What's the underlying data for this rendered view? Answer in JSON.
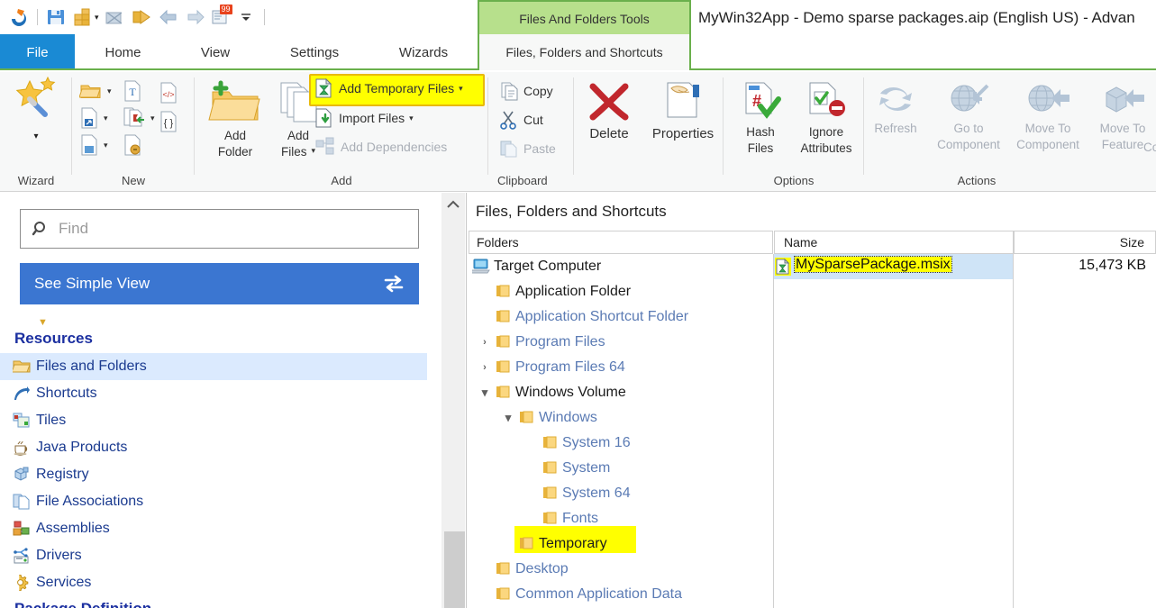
{
  "window": {
    "title": "MyWin32App - Demo sparse packages.aip (English US) - Advan",
    "contextual_tab_header": "Files And Folders Tools"
  },
  "quick_access": {
    "icons": [
      "app-logo-icon",
      "save-icon",
      "build-icon",
      "build-dropdown-caret",
      "build-and-run-icon",
      "run-icon",
      "back-arrow-icon",
      "forward-arrow-icon",
      "errors-badge-icon",
      "customize-qat-caret"
    ],
    "errors_badge": "99"
  },
  "tabs": [
    {
      "label": "File",
      "name": "tab-file",
      "state": "active-file"
    },
    {
      "label": "Home",
      "name": "tab-home",
      "state": "normal"
    },
    {
      "label": "View",
      "name": "tab-view",
      "state": "normal"
    },
    {
      "label": "Settings",
      "name": "tab-settings",
      "state": "normal"
    },
    {
      "label": "Wizards",
      "name": "tab-wizards",
      "state": "normal"
    },
    {
      "label": "Files, Folders and Shortcuts",
      "name": "tab-files-folders-shortcuts",
      "state": "selected-contextual"
    }
  ],
  "ribbon": {
    "groups": [
      {
        "label": "Wizard"
      },
      {
        "label": "New"
      },
      {
        "label": "Add"
      },
      {
        "label": "Clipboard"
      },
      {
        "label": "Options"
      },
      {
        "label": "Actions"
      }
    ],
    "wizard": {
      "button_label": "",
      "dropdown_caret": "▾"
    },
    "new_group": {
      "icons": [
        "new-folder-icon",
        "new-text-file-icon",
        "new-html-file-icon",
        "new-shortcut-icon",
        "new-import-shortcut-icon",
        "new-json-file-icon",
        "new-app-file-icon",
        "new-signed-file-icon"
      ]
    },
    "add_group": {
      "add_folder": "Add\nFolder",
      "add_folder_l1": "Add",
      "add_folder_l2": "Folder",
      "add_files_l1": "Add",
      "add_files_l2": "Files",
      "add_temporary_files": "Add Temporary Files",
      "import_files": "Import Files",
      "add_dependencies": "Add Dependencies"
    },
    "clipboard": {
      "copy": "Copy",
      "cut": "Cut",
      "paste": "Paste"
    },
    "delete": "Delete",
    "properties": "Properties",
    "options": {
      "hash_files_l1": "Hash",
      "hash_files_l2": "Files",
      "ignore_attributes_l1": "Ignore",
      "ignore_attributes_l2": "Attributes"
    },
    "actions": {
      "refresh": "Refresh",
      "go_to_component_l1": "Go to",
      "go_to_component_l2": "Component",
      "move_to_component_l1": "Move To",
      "move_to_component_l2": "Component",
      "move_to_feature_l1": "Move To",
      "move_to_feature_l2": "Feature",
      "cut_off_l1": "Co"
    }
  },
  "sidebar": {
    "search": {
      "placeholder": "Find",
      "value": ""
    },
    "simple_view_button": "See Simple View",
    "section_header": "Resources",
    "partial_section_header_below": "Package Definition",
    "items": [
      {
        "label": "Files and Folders",
        "icon": "open-folder-icon",
        "selected": true
      },
      {
        "label": "Shortcuts",
        "icon": "shortcut-arrow-icon",
        "selected": false
      },
      {
        "label": "Tiles",
        "icon": "tiles-icon",
        "selected": false
      },
      {
        "label": "Java Products",
        "icon": "coffee-cup-icon",
        "selected": false
      },
      {
        "label": "Registry",
        "icon": "registry-blocks-icon",
        "selected": false
      },
      {
        "label": "File Associations",
        "icon": "file-associations-icon",
        "selected": false
      },
      {
        "label": "Assemblies",
        "icon": "assemblies-icon",
        "selected": false
      },
      {
        "label": "Drivers",
        "icon": "drivers-icon",
        "selected": false
      },
      {
        "label": "Services",
        "icon": "services-gear-icon",
        "selected": false
      }
    ]
  },
  "main": {
    "panel_title": "Files, Folders and Shortcuts",
    "folders_column_header": "Folders",
    "name_column_header": "Name",
    "size_column_header": "Size",
    "tree": [
      {
        "label": "Target Computer",
        "depth": 0,
        "icon": "computer-icon",
        "toggle": "",
        "style": "dark",
        "highlight": false
      },
      {
        "label": "Application Folder",
        "depth": 1,
        "icon": "folder-icon",
        "toggle": "",
        "style": "dark",
        "highlight": false
      },
      {
        "label": "Application Shortcut Folder",
        "depth": 1,
        "icon": "folder-icon",
        "toggle": "",
        "style": "blue",
        "highlight": false
      },
      {
        "label": "Program Files",
        "depth": 1,
        "icon": "folder-icon",
        "toggle": "›",
        "style": "blue",
        "highlight": false
      },
      {
        "label": "Program Files 64",
        "depth": 1,
        "icon": "folder-icon",
        "toggle": "›",
        "style": "blue",
        "highlight": false
      },
      {
        "label": "Windows Volume",
        "depth": 1,
        "icon": "folder-icon",
        "toggle": "⌄",
        "style": "dark",
        "highlight": false
      },
      {
        "label": "Windows",
        "depth": 2,
        "icon": "folder-icon",
        "toggle": "⌄",
        "style": "blue",
        "highlight": false
      },
      {
        "label": "System 16",
        "depth": 3,
        "icon": "folder-icon",
        "toggle": "",
        "style": "blue",
        "highlight": false
      },
      {
        "label": "System",
        "depth": 3,
        "icon": "folder-icon",
        "toggle": "",
        "style": "blue",
        "highlight": false
      },
      {
        "label": "System 64",
        "depth": 3,
        "icon": "folder-icon",
        "toggle": "",
        "style": "blue",
        "highlight": false
      },
      {
        "label": "Fonts",
        "depth": 3,
        "icon": "folder-icon",
        "toggle": "",
        "style": "blue",
        "highlight": false
      },
      {
        "label": "Temporary",
        "depth": 2,
        "icon": "folder-icon",
        "toggle": "",
        "style": "dark",
        "highlight": true
      },
      {
        "label": "Desktop",
        "depth": 1,
        "icon": "folder-icon",
        "toggle": "",
        "style": "blue",
        "highlight": false
      },
      {
        "label": "Common Application Data",
        "depth": 1,
        "icon": "folder-icon",
        "toggle": "",
        "style": "blue",
        "highlight": false
      }
    ],
    "files": [
      {
        "name": "MySparsePackage.msix",
        "size": "15,473 KB",
        "icon": "temporary-file-icon",
        "selected": true,
        "highlight": true
      }
    ]
  },
  "colors": {
    "file_tab_blue": "#1a8ad4",
    "contextual_green": "#b7e08c",
    "contextual_green_border": "#6ab04c",
    "simple_view_blue": "#3b76d1",
    "highlight_yellow": "#ffff00",
    "selection_blue": "#cfe4f7",
    "sidebar_selection": "#dbeafe",
    "tree_blue_text": "#5b7bb4",
    "section_header_navy": "#1b2fa0"
  }
}
